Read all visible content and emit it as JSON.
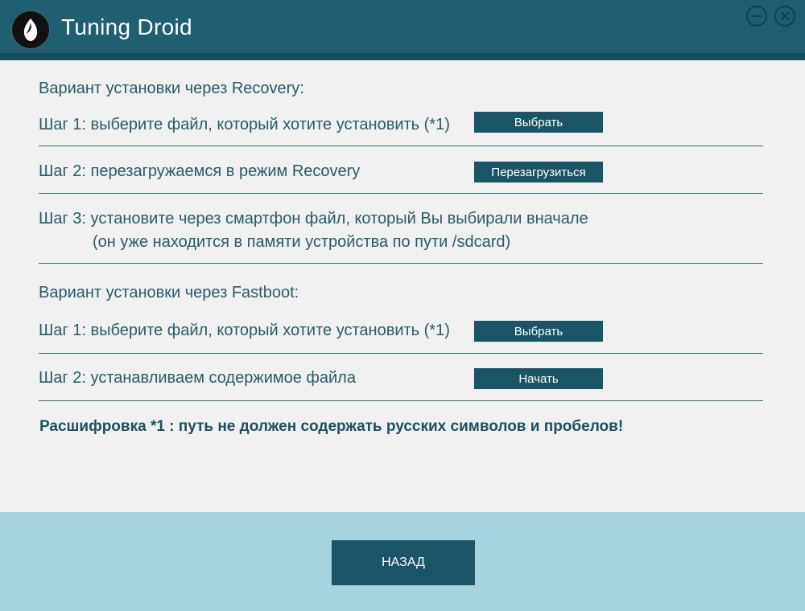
{
  "window": {
    "title": "Tuning Droid",
    "logo_icon": "android-leaf-icon",
    "minimize_icon": "minimize-icon",
    "close_icon": "close-icon",
    "colors": {
      "titlebar": "#1e5f70",
      "button": "#1a5565",
      "text": "#2a5b68",
      "footer": "#a5d4de",
      "background": "#f0f0f0"
    }
  },
  "recovery": {
    "heading": "Вариант установки через Recovery:",
    "step1": {
      "text": "Шаг 1: выберите файл, который хотите установить (*1)",
      "button": "Выбрать"
    },
    "step2": {
      "text": "Шаг 2: перезагружаемся в режим Recovery",
      "button": "Перезагрузиться"
    },
    "step3": {
      "line1": "Шаг 3: установите через смартфон файл, который Вы выбирали вначале",
      "line2": "(он уже находится в памяти устройства по пути /sdcard)"
    }
  },
  "fastboot": {
    "heading": "Вариант установки через Fastboot:",
    "step1": {
      "text": "Шаг 1: выберите файл, который хотите установить (*1)",
      "button": "Выбрать"
    },
    "step2": {
      "text": "Шаг 2: устанавливаем содержимое файла",
      "button": "Начать"
    }
  },
  "note": "Расшифровка *1 : путь не должен содержать русских символов и пробелов!",
  "footer": {
    "back_button": "НАЗАД"
  }
}
